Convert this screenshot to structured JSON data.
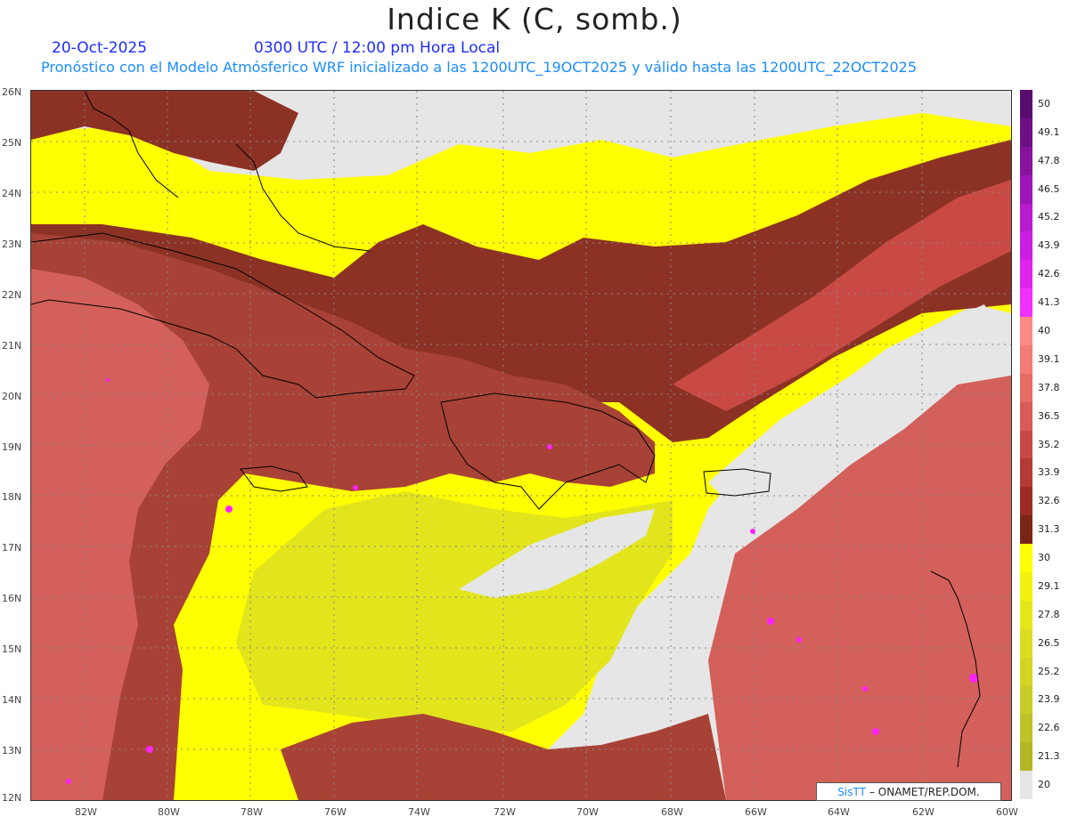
{
  "header": {
    "title": "Indice K (C, somb.)",
    "date": "20-Oct-2025",
    "valid_time": "0300 UTC / 12:00 pm Hora Local",
    "subtitle": "Pronóstico con el Modelo Atmósferico WRF inicializado a las 1200UTC_19OCT2025 y válido hasta las  1200UTC_22OCT2025"
  },
  "axes": {
    "lat_labels": [
      "26N",
      "25N",
      "24N",
      "23N",
      "22N",
      "21N",
      "20N",
      "19N",
      "18N",
      "17N",
      "16N",
      "15N",
      "14N",
      "13N",
      "12N"
    ],
    "lon_labels": [
      "82W",
      "80W",
      "78W",
      "76W",
      "74W",
      "72W",
      "70W",
      "68W",
      "66W",
      "64W",
      "62W",
      "60W"
    ]
  },
  "colorbar": {
    "labels": [
      "50",
      "49.1",
      "47.8",
      "46.5",
      "45.2",
      "43.9",
      "42.6",
      "41.3",
      "40",
      "39.1",
      "37.8",
      "36.5",
      "35.2",
      "33.9",
      "32.6",
      "31.3",
      "30",
      "29.1",
      "27.8",
      "26.5",
      "25.2",
      "23.9",
      "22.6",
      "21.3",
      "20"
    ],
    "colors": [
      "#5a0c6e",
      "#6e0f86",
      "#86129e",
      "#9c16b8",
      "#b81ad0",
      "#cc1ee0",
      "#e024ee",
      "#f030ff",
      "#ff8888",
      "#f27b74",
      "#e56c63",
      "#d85c55",
      "#c94a44",
      "#b33a35",
      "#9c2c24",
      "#7a2617",
      "#ffff00",
      "#f1f20d",
      "#e6e718",
      "#dadd20",
      "#d3d523",
      "#c9cc25",
      "#bfc226",
      "#b3b722",
      "#e6e6e6"
    ]
  },
  "map_colors": {
    "background": "#e6e6e6",
    "low_yellow": "#ffff00",
    "mid_yellow": "#e3e51c",
    "dark_red": "#8c3224",
    "mid_red": "#a84236",
    "salmon": "#d3605a",
    "magenta": "#ff20ff",
    "coastline": "#000000",
    "grid": "#888888"
  },
  "credit": {
    "brand": "SisTT",
    "text": "– ONAMET/REP.DOM."
  }
}
